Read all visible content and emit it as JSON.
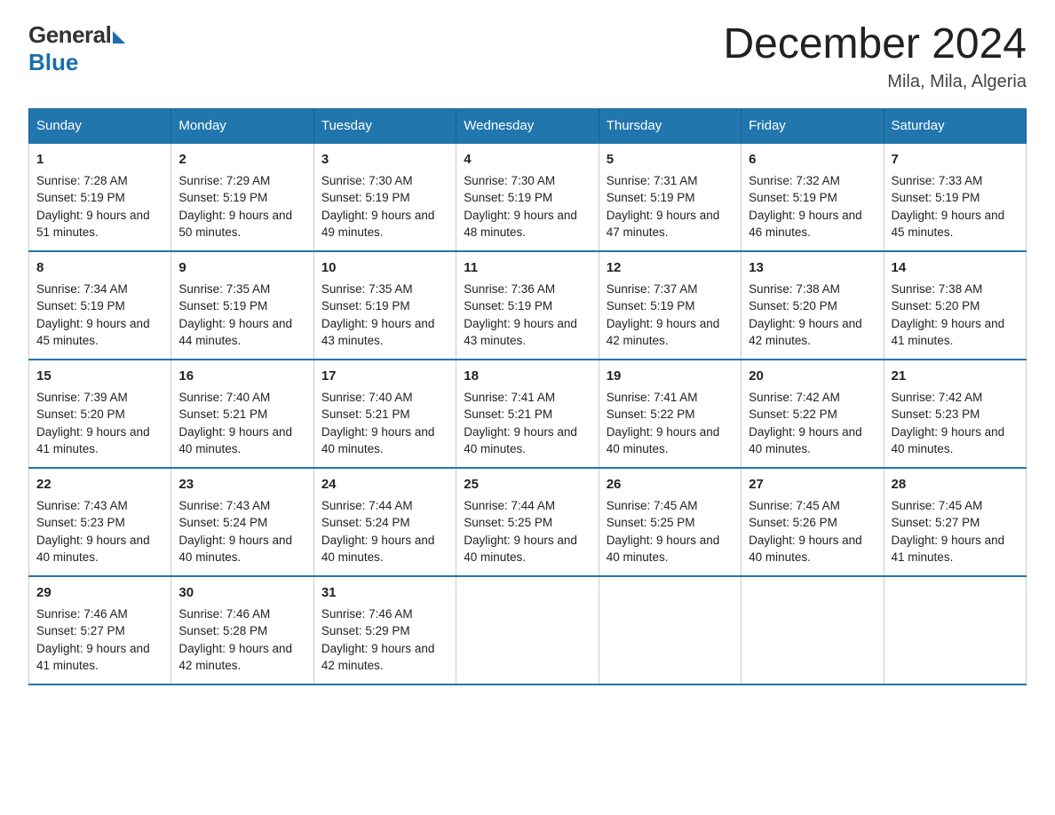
{
  "header": {
    "logo_general": "General",
    "logo_blue": "Blue",
    "month_title": "December 2024",
    "location": "Mila, Mila, Algeria"
  },
  "weekdays": [
    "Sunday",
    "Monday",
    "Tuesday",
    "Wednesday",
    "Thursday",
    "Friday",
    "Saturday"
  ],
  "weeks": [
    [
      {
        "day": "1",
        "sunrise": "7:28 AM",
        "sunset": "5:19 PM",
        "daylight": "9 hours and 51 minutes."
      },
      {
        "day": "2",
        "sunrise": "7:29 AM",
        "sunset": "5:19 PM",
        "daylight": "9 hours and 50 minutes."
      },
      {
        "day": "3",
        "sunrise": "7:30 AM",
        "sunset": "5:19 PM",
        "daylight": "9 hours and 49 minutes."
      },
      {
        "day": "4",
        "sunrise": "7:30 AM",
        "sunset": "5:19 PM",
        "daylight": "9 hours and 48 minutes."
      },
      {
        "day": "5",
        "sunrise": "7:31 AM",
        "sunset": "5:19 PM",
        "daylight": "9 hours and 47 minutes."
      },
      {
        "day": "6",
        "sunrise": "7:32 AM",
        "sunset": "5:19 PM",
        "daylight": "9 hours and 46 minutes."
      },
      {
        "day": "7",
        "sunrise": "7:33 AM",
        "sunset": "5:19 PM",
        "daylight": "9 hours and 45 minutes."
      }
    ],
    [
      {
        "day": "8",
        "sunrise": "7:34 AM",
        "sunset": "5:19 PM",
        "daylight": "9 hours and 45 minutes."
      },
      {
        "day": "9",
        "sunrise": "7:35 AM",
        "sunset": "5:19 PM",
        "daylight": "9 hours and 44 minutes."
      },
      {
        "day": "10",
        "sunrise": "7:35 AM",
        "sunset": "5:19 PM",
        "daylight": "9 hours and 43 minutes."
      },
      {
        "day": "11",
        "sunrise": "7:36 AM",
        "sunset": "5:19 PM",
        "daylight": "9 hours and 43 minutes."
      },
      {
        "day": "12",
        "sunrise": "7:37 AM",
        "sunset": "5:19 PM",
        "daylight": "9 hours and 42 minutes."
      },
      {
        "day": "13",
        "sunrise": "7:38 AM",
        "sunset": "5:20 PM",
        "daylight": "9 hours and 42 minutes."
      },
      {
        "day": "14",
        "sunrise": "7:38 AM",
        "sunset": "5:20 PM",
        "daylight": "9 hours and 41 minutes."
      }
    ],
    [
      {
        "day": "15",
        "sunrise": "7:39 AM",
        "sunset": "5:20 PM",
        "daylight": "9 hours and 41 minutes."
      },
      {
        "day": "16",
        "sunrise": "7:40 AM",
        "sunset": "5:21 PM",
        "daylight": "9 hours and 40 minutes."
      },
      {
        "day": "17",
        "sunrise": "7:40 AM",
        "sunset": "5:21 PM",
        "daylight": "9 hours and 40 minutes."
      },
      {
        "day": "18",
        "sunrise": "7:41 AM",
        "sunset": "5:21 PM",
        "daylight": "9 hours and 40 minutes."
      },
      {
        "day": "19",
        "sunrise": "7:41 AM",
        "sunset": "5:22 PM",
        "daylight": "9 hours and 40 minutes."
      },
      {
        "day": "20",
        "sunrise": "7:42 AM",
        "sunset": "5:22 PM",
        "daylight": "9 hours and 40 minutes."
      },
      {
        "day": "21",
        "sunrise": "7:42 AM",
        "sunset": "5:23 PM",
        "daylight": "9 hours and 40 minutes."
      }
    ],
    [
      {
        "day": "22",
        "sunrise": "7:43 AM",
        "sunset": "5:23 PM",
        "daylight": "9 hours and 40 minutes."
      },
      {
        "day": "23",
        "sunrise": "7:43 AM",
        "sunset": "5:24 PM",
        "daylight": "9 hours and 40 minutes."
      },
      {
        "day": "24",
        "sunrise": "7:44 AM",
        "sunset": "5:24 PM",
        "daylight": "9 hours and 40 minutes."
      },
      {
        "day": "25",
        "sunrise": "7:44 AM",
        "sunset": "5:25 PM",
        "daylight": "9 hours and 40 minutes."
      },
      {
        "day": "26",
        "sunrise": "7:45 AM",
        "sunset": "5:25 PM",
        "daylight": "9 hours and 40 minutes."
      },
      {
        "day": "27",
        "sunrise": "7:45 AM",
        "sunset": "5:26 PM",
        "daylight": "9 hours and 40 minutes."
      },
      {
        "day": "28",
        "sunrise": "7:45 AM",
        "sunset": "5:27 PM",
        "daylight": "9 hours and 41 minutes."
      }
    ],
    [
      {
        "day": "29",
        "sunrise": "7:46 AM",
        "sunset": "5:27 PM",
        "daylight": "9 hours and 41 minutes."
      },
      {
        "day": "30",
        "sunrise": "7:46 AM",
        "sunset": "5:28 PM",
        "daylight": "9 hours and 42 minutes."
      },
      {
        "day": "31",
        "sunrise": "7:46 AM",
        "sunset": "5:29 PM",
        "daylight": "9 hours and 42 minutes."
      },
      null,
      null,
      null,
      null
    ]
  ]
}
